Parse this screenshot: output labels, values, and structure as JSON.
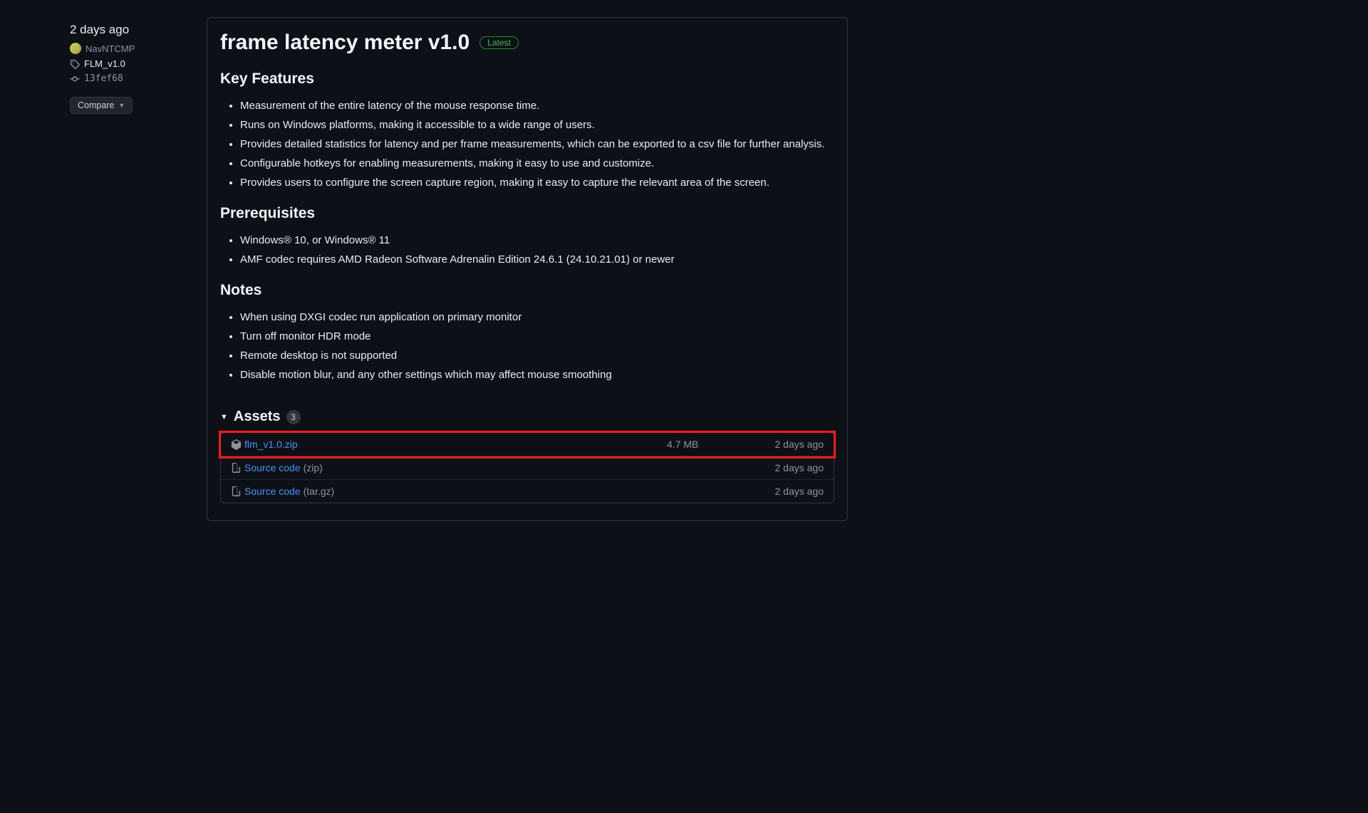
{
  "sidebar": {
    "date": "2 days ago",
    "author": "NavNTCMP",
    "tag": "FLM_v1.0",
    "commit": "13fef68",
    "compare_label": "Compare"
  },
  "release": {
    "title": "frame latency meter v1.0",
    "badge": "Latest",
    "sections": {
      "features_heading": "Key Features",
      "features": [
        "Measurement of the entire latency of the mouse response time.",
        "Runs on Windows platforms, making it accessible to a wide range of users.",
        "Provides detailed statistics for latency and per frame measurements, which can be exported to a csv file for further analysis.",
        "Configurable hotkeys for enabling measurements, making it easy to use and customize.",
        "Provides users to configure the screen capture region, making it easy to capture the relevant area of the screen."
      ],
      "prereq_heading": "Prerequisites",
      "prereq": [
        "Windows® 10, or Windows® 11",
        "AMF codec requires AMD Radeon Software Adrenalin Edition 24.6.1 (24.10.21.01) or newer"
      ],
      "notes_heading": "Notes",
      "notes": [
        "When using DXGI codec run application on primary monitor",
        "Turn off monitor HDR mode",
        "Remote desktop is not supported",
        "Disable motion blur, and any other settings which may affect mouse smoothing"
      ]
    },
    "assets": {
      "heading": "Assets",
      "count": "3",
      "items": [
        {
          "name": "flm_v1.0.zip",
          "size": "4.7 MB",
          "date": "2 days ago",
          "suffix": ""
        },
        {
          "name": "Source code",
          "size": "",
          "date": "2 days ago",
          "suffix": "(zip)"
        },
        {
          "name": "Source code",
          "size": "",
          "date": "2 days ago",
          "suffix": "(tar.gz)"
        }
      ]
    }
  }
}
